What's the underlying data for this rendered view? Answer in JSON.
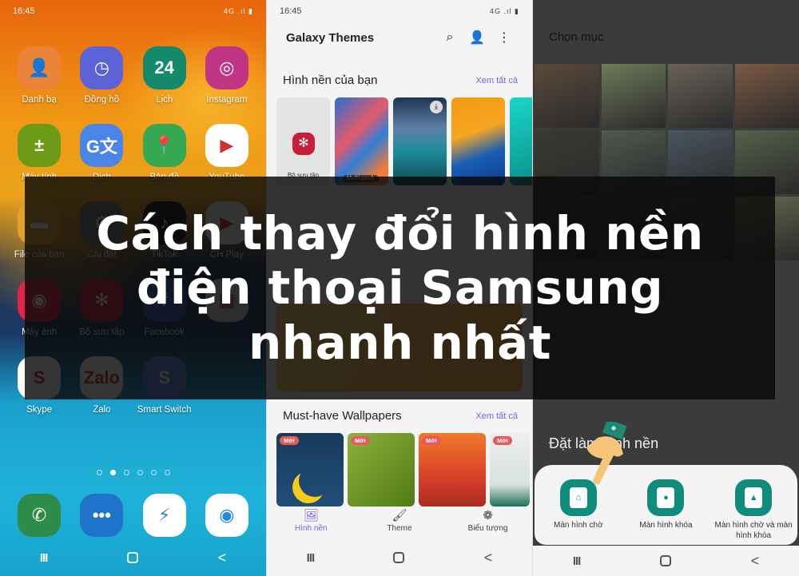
{
  "status_time": "16:45",
  "status_signal": "4G .ıl ▮",
  "home": {
    "apps": [
      {
        "label": "Danh bạ",
        "glyph": "👤",
        "color": "#e9843a"
      },
      {
        "label": "Đồng hồ",
        "glyph": "◷",
        "color": "#5b63d6"
      },
      {
        "label": "Lịch",
        "glyph": "24",
        "color": "#138a6c"
      },
      {
        "label": "Instagram",
        "glyph": "◎",
        "color": "#c13584"
      },
      {
        "label": "Máy tính",
        "glyph": "±",
        "color": "#6e9a1a"
      },
      {
        "label": "Dịch",
        "glyph": "G文",
        "color": "#4a86e8"
      },
      {
        "label": "Bản đồ",
        "glyph": "📍",
        "color": "#34a853"
      },
      {
        "label": "YouTube",
        "glyph": "▶",
        "color": "#ffffff"
      },
      {
        "label": "File của bạn",
        "glyph": "▬",
        "color": "#e0a02a"
      },
      {
        "label": "Cài đặt",
        "glyph": "⚙",
        "color": "#6a6f78"
      },
      {
        "label": "TikTok",
        "glyph": "♪",
        "color": "#111111"
      },
      {
        "label": "CH Play",
        "glyph": "▶",
        "color": "#f4f4f4"
      },
      {
        "label": "Máy ảnh",
        "glyph": "◉",
        "color": "#e0244a"
      },
      {
        "label": "Bộ sưu tập",
        "glyph": "✻",
        "color": "#c81e3c"
      },
      {
        "label": "Facebook",
        "glyph": "f",
        "color": "#2d5fb8"
      },
      {
        "label": "",
        "glyph": "▦",
        "color": "#cfcfcf"
      },
      {
        "label": "Skype",
        "glyph": "S",
        "color": "#ffffff"
      },
      {
        "label": "Zalo",
        "glyph": "Zalo",
        "color": "#ffffff"
      },
      {
        "label": "Smart Switch",
        "glyph": "S",
        "color": "#5b7fe0"
      }
    ],
    "page_count": 6,
    "active_page": 1,
    "dock": [
      {
        "name": "phone",
        "glyph": "✆",
        "color": "#2e8c4a"
      },
      {
        "name": "messages",
        "glyph": "•••",
        "color": "#1f74c9"
      },
      {
        "name": "messenger",
        "glyph": "⚡",
        "color": "#ffffff"
      },
      {
        "name": "chrome",
        "glyph": "◉",
        "color": "#ffffff"
      }
    ]
  },
  "themes": {
    "title": "Galaxy Themes",
    "section1_title": "Hình nền của bạn",
    "see_all": "Xem tất cả",
    "gallery_card": "Bộ sưu tập",
    "multipack": "Multi-pack",
    "section2_title": "Must-have Wallpapers",
    "new_badge": "Mới",
    "tabs": [
      {
        "label": "Hình nền",
        "icon": "🖼",
        "active": true
      },
      {
        "label": "Theme",
        "icon": "🖌",
        "active": false
      },
      {
        "label": "Biểu tượng",
        "icon": "❁",
        "active": false
      }
    ]
  },
  "picker": {
    "title": "Chọn mục",
    "sheet_title": "Đặt làm hình nền",
    "options": [
      {
        "label": "Màn hình chờ",
        "icon": "⌂"
      },
      {
        "label": "Màn hình khóa",
        "icon": "●"
      },
      {
        "label": "Màn hình chờ và màn hình khóa",
        "icon": "▲"
      }
    ]
  },
  "banner": {
    "line1": "Cách thay đổi hình nền",
    "line2": "điện thoại Samsung",
    "line3": "nhanh nhất"
  },
  "nav": {
    "recent": "III",
    "back": "<"
  }
}
